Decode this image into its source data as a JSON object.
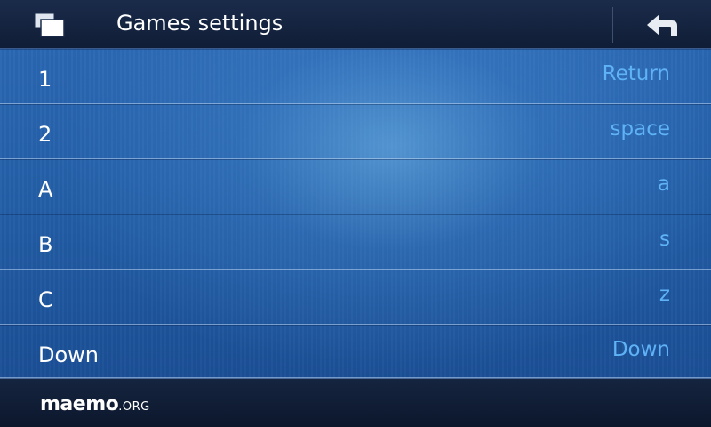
{
  "window": {
    "title": "Games settings"
  },
  "icons": {
    "task_switcher": "task-switcher-icon",
    "back": "back-arrow-icon"
  },
  "settings": [
    {
      "label": "1",
      "value": "Return"
    },
    {
      "label": "2",
      "value": "space"
    },
    {
      "label": "A",
      "value": "a"
    },
    {
      "label": "B",
      "value": "s"
    },
    {
      "label": "C",
      "value": "z"
    },
    {
      "label": "Down",
      "value": "Down"
    }
  ],
  "footer": {
    "brand_main": "maemo",
    "brand_suffix": ".ORG"
  },
  "colors": {
    "label": "#ffffff",
    "value": "#5fb2f6",
    "list_background": "#2460a9"
  }
}
